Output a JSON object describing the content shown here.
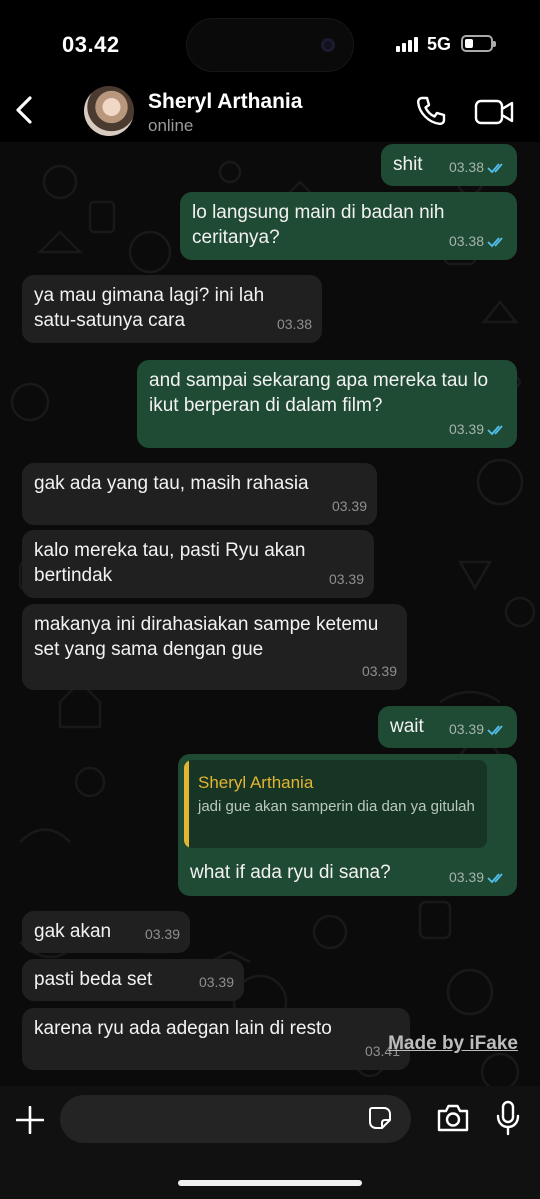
{
  "status_bar": {
    "time": "03.42",
    "network": "5G"
  },
  "header": {
    "contact_name": "Sheryl Arthania",
    "contact_status": "online"
  },
  "messages": [
    {
      "dir": "out",
      "text": "shit",
      "time": "03.38"
    },
    {
      "dir": "out",
      "text": "lo langsung main di badan nih ceritanya?",
      "time": "03.38"
    },
    {
      "dir": "in",
      "text": "ya mau gimana lagi? ini lah satu-satunya cara",
      "time": "03.38"
    },
    {
      "dir": "out",
      "text": "and sampai sekarang apa mereka tau lo ikut berperan di dalam film?",
      "time": "03.39"
    },
    {
      "dir": "in",
      "text": "gak ada yang tau, masih rahasia",
      "time": "03.39"
    },
    {
      "dir": "in",
      "text": "kalo mereka tau, pasti Ryu akan bertindak",
      "time": "03.39"
    },
    {
      "dir": "in",
      "text": "makanya ini dirahasiakan sampe ketemu set yang sama dengan gue",
      "time": "03.39"
    },
    {
      "dir": "out",
      "text": "wait",
      "time": "03.39"
    },
    {
      "dir": "out",
      "text": "what if ada ryu di sana?",
      "time": "03.39",
      "reply": {
        "name": "Sheryl Arthania",
        "text": "jadi gue akan samperin dia dan ya gitulah"
      }
    },
    {
      "dir": "in",
      "text": "gak akan",
      "time": "03.39"
    },
    {
      "dir": "in",
      "text": "pasti beda set",
      "time": "03.39"
    },
    {
      "dir": "in",
      "text": "karena ryu ada adegan lain di resto",
      "time": "03.41"
    }
  ],
  "watermark": "Made by iFake",
  "composer": {
    "placeholder": ""
  },
  "icons": [
    "back-chevron-icon",
    "phone-icon",
    "video-call-icon",
    "plus-icon",
    "sticker-icon",
    "camera-icon",
    "microphone-icon",
    "read-receipt-icon"
  ],
  "colors": {
    "outgoing_bubble": "#1f4a33",
    "incoming_bubble": "#202020",
    "read_ticks": "#53bdeb",
    "reply_accent": "#e3b533"
  }
}
